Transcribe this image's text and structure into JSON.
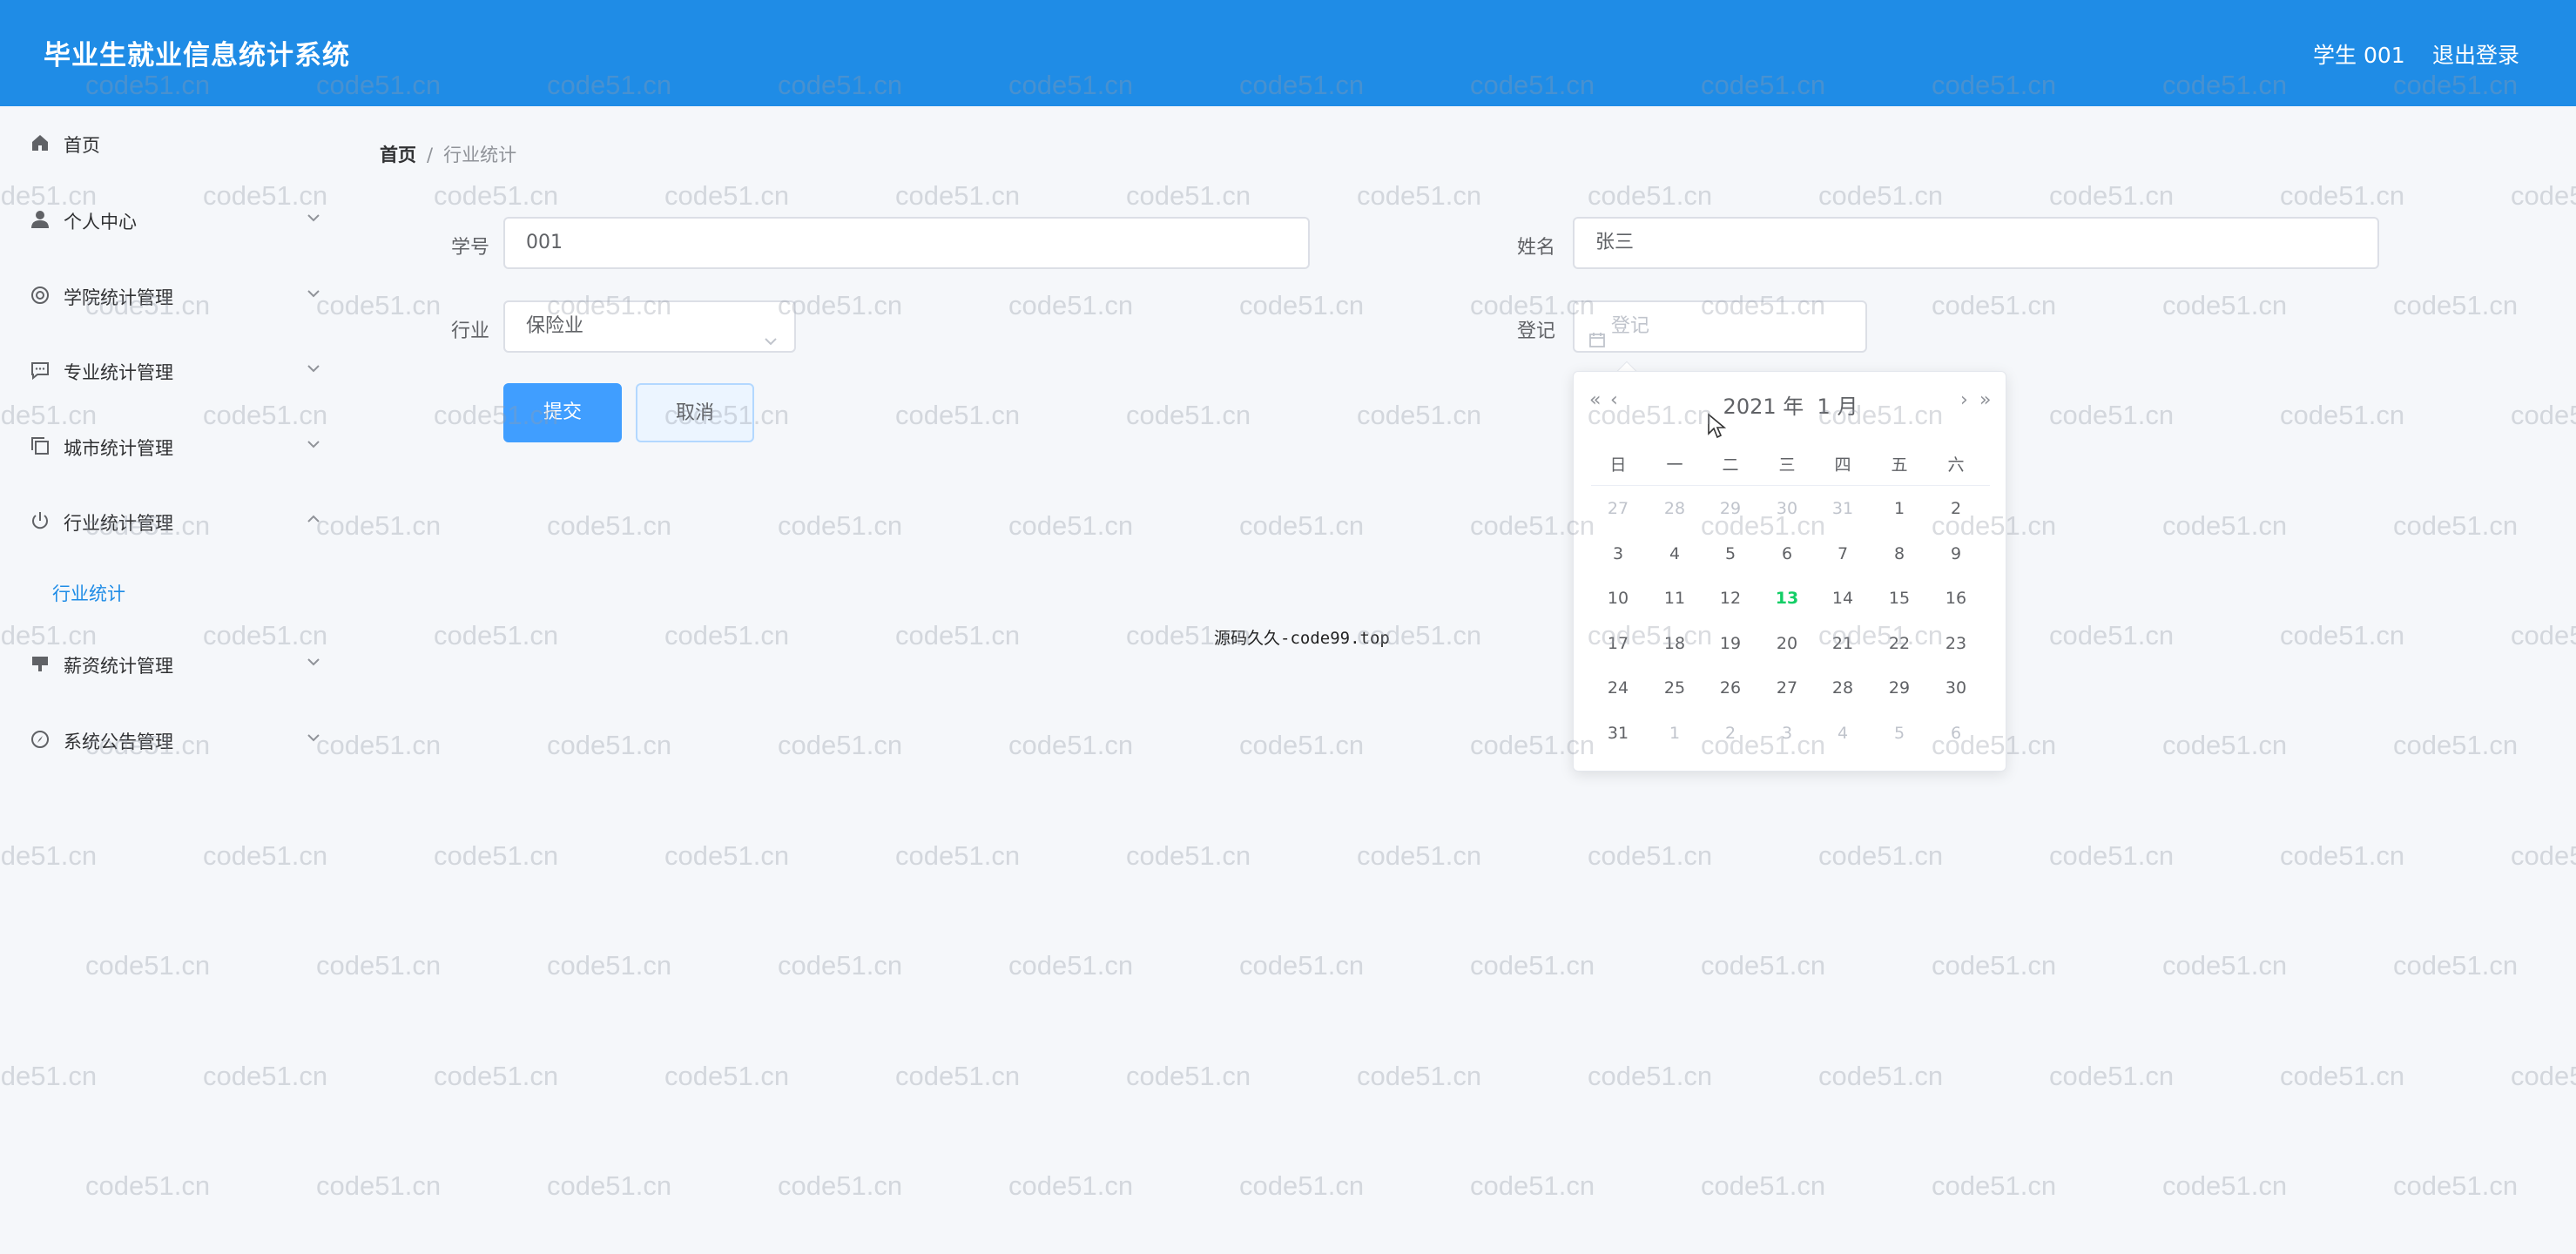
{
  "header": {
    "title": "毕业生就业信息统计系统",
    "user": "学生 001",
    "logout": "退出登录"
  },
  "sidebar": {
    "items": [
      {
        "label": "首页",
        "icon": "home-icon"
      },
      {
        "label": "个人中心",
        "icon": "user-icon"
      },
      {
        "label": "学院统计管理",
        "icon": "college-icon"
      },
      {
        "label": "专业统计管理",
        "icon": "chat-icon"
      },
      {
        "label": "城市统计管理",
        "icon": "copy-icon"
      },
      {
        "label": "行业统计管理",
        "icon": "power-icon"
      },
      {
        "label": "薪资统计管理",
        "icon": "money-icon"
      },
      {
        "label": "系统公告管理",
        "icon": "compass-icon"
      }
    ],
    "active_sub": "行业统计"
  },
  "breadcrumb": {
    "home": "首页",
    "separator": "/",
    "current": "行业统计"
  },
  "form": {
    "student_id_label": "学号",
    "student_id_value": "001",
    "name_label": "姓名",
    "name_value": "张三",
    "industry_label": "行业",
    "industry_value": "保险业",
    "register_label": "登记",
    "register_placeholder": "登记",
    "submit": "提交",
    "cancel": "取消"
  },
  "source_text": "源码久久-code99.top",
  "datepicker": {
    "year": "2021",
    "year_suffix": "年",
    "month": "1",
    "month_suffix": "月",
    "prev_year": "«",
    "prev_month": "‹",
    "next_month": "›",
    "next_year": "»",
    "weekdays": [
      "日",
      "一",
      "二",
      "三",
      "四",
      "五",
      "六"
    ],
    "today": "13",
    "weeks": [
      [
        {
          "d": "27",
          "o": true
        },
        {
          "d": "28",
          "o": true
        },
        {
          "d": "29",
          "o": true
        },
        {
          "d": "30",
          "o": true
        },
        {
          "d": "31",
          "o": true
        },
        {
          "d": "1"
        },
        {
          "d": "2"
        }
      ],
      [
        {
          "d": "3"
        },
        {
          "d": "4"
        },
        {
          "d": "5"
        },
        {
          "d": "6"
        },
        {
          "d": "7"
        },
        {
          "d": "8"
        },
        {
          "d": "9"
        }
      ],
      [
        {
          "d": "10"
        },
        {
          "d": "11"
        },
        {
          "d": "12"
        },
        {
          "d": "13"
        },
        {
          "d": "14"
        },
        {
          "d": "15"
        },
        {
          "d": "16"
        }
      ],
      [
        {
          "d": "17"
        },
        {
          "d": "18"
        },
        {
          "d": "19"
        },
        {
          "d": "20"
        },
        {
          "d": "21"
        },
        {
          "d": "22"
        },
        {
          "d": "23"
        }
      ],
      [
        {
          "d": "24"
        },
        {
          "d": "25"
        },
        {
          "d": "26"
        },
        {
          "d": "27"
        },
        {
          "d": "28"
        },
        {
          "d": "29"
        },
        {
          "d": "30"
        }
      ],
      [
        {
          "d": "31"
        },
        {
          "d": "1",
          "o": true
        },
        {
          "d": "2",
          "o": true
        },
        {
          "d": "3",
          "o": true
        },
        {
          "d": "4",
          "o": true
        },
        {
          "d": "5",
          "o": true
        },
        {
          "d": "6",
          "o": true
        }
      ]
    ]
  },
  "watermark": "code51.cn",
  "colors": {
    "header": "#1f8ce6",
    "primary": "#409eff",
    "today": "#13ce66",
    "background": "#f5f7fa"
  }
}
